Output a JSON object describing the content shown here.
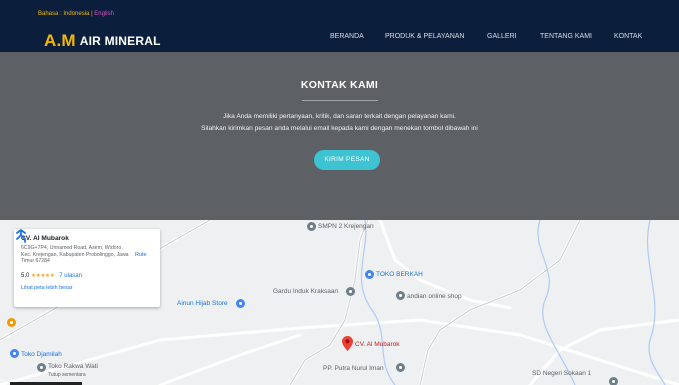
{
  "header": {
    "lang_label": "Bahasa :",
    "lang_id": "Indonesia",
    "lang_sep": "|",
    "lang_en": "English",
    "logo_am": "A.M",
    "logo_text": "AIR MINERAL",
    "nav": [
      "BERANDA",
      "PRODUK & PELAYANAN",
      "GALLERI",
      "TENTANG KAMI",
      "KONTAK"
    ]
  },
  "hero": {
    "title": "KONTAK KAMI",
    "line1": "Jika Anda memiliki pertanyaan, kritik, dan saran terkait dengan pelayanan kami.",
    "line2": "Silahkan kirimkan pesan anda melalui email kepada kami dengan menekan tombol dibawah ini",
    "button": "KIRIM PESAN"
  },
  "map_card": {
    "title": "CV. Al Mubarok",
    "address": "6C9G+7P4, Unnamed Road, Asem, Widoro, Kec. Krejengan, Kabupaten Probolinggo, Jawa Timur 67284",
    "rating": "5,0",
    "stars": "★★★★★",
    "reviews": "7 ulasan",
    "larger_map": "Lihat peta lebih besar",
    "directions": "Rute"
  },
  "map_places": {
    "smpn": "SMPN 2 Krejengan",
    "toko_berkah": "TOKO BERKAH",
    "gardu": "Gardu Induk Kraksaan",
    "andian": "andian online shop",
    "ainun": "Ainun Hijab Store",
    "djamilah": "Toko Djamilah",
    "rakwa": "Toko Rakwa Wati",
    "rakwa_sub": "Tutup sementara",
    "mubarok": "CV. Al Mubarok",
    "putra": "PP. Putra Nurul Iman",
    "sdn": "SD Negeri Sokaan 1"
  },
  "colors": {
    "nav_bg": "#0b1f3d",
    "accent": "#f5b800",
    "hero_bg": "#5d6165",
    "button": "#3ec3d3"
  }
}
